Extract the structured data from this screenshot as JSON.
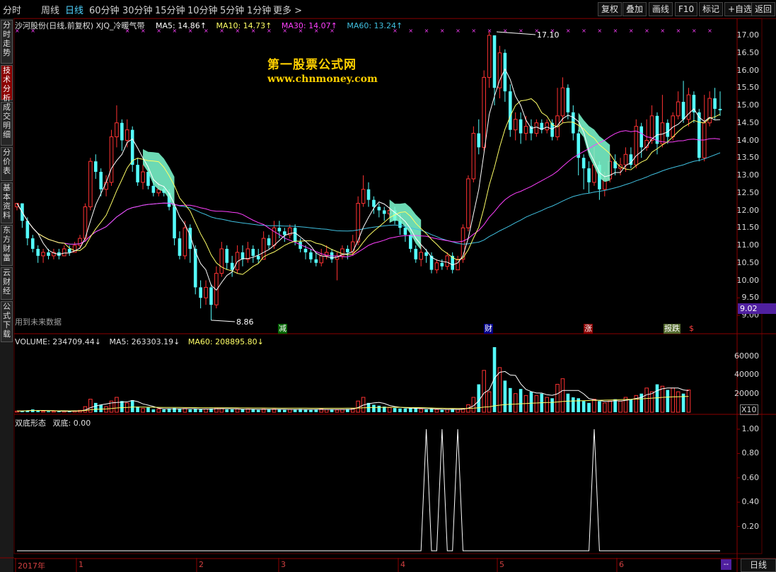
{
  "toolbar": {
    "periods": [
      "分时",
      "周线",
      "日线",
      "60分钟",
      "30分钟",
      "15分钟",
      "10分钟",
      "5分钟",
      "1分钟",
      "更多 >"
    ],
    "active_period": "日线",
    "right_buttons": [
      "复权",
      "叠加",
      "画线",
      "F10",
      "标记",
      "+自选",
      "返回"
    ]
  },
  "leftnav": {
    "tabs": [
      "分时走势",
      "技术分析",
      "成交明细",
      "分价表",
      "基本资料",
      "东方财富",
      "云财经",
      "公式下载"
    ],
    "active": "技术分析"
  },
  "main_info": {
    "title": "沙河股份(日线,前复权) XJQ_冷暖气带",
    "ma5": "MA5: 14.86↑",
    "ma10": "MA10: 14.73↑",
    "ma30": "MA30: 14.07↑",
    "ma60": "MA60: 13.24↑",
    "future_note": "用到未来数据"
  },
  "watermark": {
    "line1": "第一股票公式网",
    "line2": "www.chnmoney.com"
  },
  "price_axis": [
    "17.00",
    "16.50",
    "16.00",
    "15.50",
    "15.00",
    "14.50",
    "14.00",
    "13.50",
    "13.00",
    "12.50",
    "12.00",
    "11.50",
    "11.00",
    "10.50",
    "10.00",
    "9.50",
    "9.00"
  ],
  "current_price": "9.02",
  "annotations": {
    "high": "17.10",
    "low": "8.86"
  },
  "events": [
    {
      "label": "减",
      "color": "#ffffff",
      "bg": "#006400"
    },
    {
      "label": "财",
      "color": "#ffffff",
      "bg": "#00008b"
    },
    {
      "label": "涨",
      "color": "#ffffff",
      "bg": "#8b0000"
    },
    {
      "label": "报跌",
      "color": "#ffffff",
      "bg": "#556b2f"
    },
    {
      "label": "$",
      "color": "#ff4040",
      "bg": "transparent"
    }
  ],
  "volume_info": {
    "volume": "VOLUME: 234709.44↓",
    "ma5": "MA5: 263303.19↓",
    "ma60": "MA60: 208895.80↓"
  },
  "volume_axis": [
    "60000",
    "40000",
    "20000"
  ],
  "volume_unit": "X10",
  "indicator_info": {
    "name": "双底形态",
    "value": "双底: 0.00"
  },
  "indicator_axis": [
    "1.00",
    "0.80",
    "0.60",
    "0.40",
    "0.20"
  ],
  "indicator_minus": "--",
  "date_axis": [
    "2017年",
    "1",
    "2",
    "3",
    "4",
    "5",
    "6"
  ],
  "period_label": "日线",
  "colors": {
    "up": "#ff3232",
    "down": "#54fcfc",
    "ma5": "#ffffff",
    "ma10": "#ffff66",
    "ma30": "#ff40ff",
    "ma60": "#40c0e0",
    "band": "#7fffd4",
    "grid": "#5a0000"
  },
  "chart_data": {
    "type": "candlestick",
    "ylim": [
      8.86,
      17.1
    ],
    "bars": [
      {
        "o": 12.1,
        "c": 12.2,
        "h": 12.2,
        "l": 12.0
      },
      {
        "o": 12.2,
        "c": 11.7,
        "h": 12.2,
        "l": 11.5
      },
      {
        "o": 11.7,
        "c": 11.2,
        "h": 11.8,
        "l": 11.0
      },
      {
        "o": 11.2,
        "c": 10.9,
        "h": 11.3,
        "l": 10.8
      },
      {
        "o": 10.9,
        "c": 10.7,
        "h": 11.0,
        "l": 10.5
      },
      {
        "o": 10.7,
        "c": 10.8,
        "h": 10.9,
        "l": 10.5
      },
      {
        "o": 10.8,
        "c": 10.7,
        "h": 10.9,
        "l": 10.6
      },
      {
        "o": 10.7,
        "c": 10.8,
        "h": 10.9,
        "l": 10.6
      },
      {
        "o": 10.8,
        "c": 10.7,
        "h": 10.9,
        "l": 10.6
      },
      {
        "o": 10.7,
        "c": 10.9,
        "h": 11.0,
        "l": 10.7
      },
      {
        "o": 10.9,
        "c": 10.8,
        "h": 11.0,
        "l": 10.7
      },
      {
        "o": 10.8,
        "c": 11.0,
        "h": 11.1,
        "l": 10.8
      },
      {
        "o": 11.0,
        "c": 11.2,
        "h": 11.3,
        "l": 10.9
      },
      {
        "o": 11.2,
        "c": 12.1,
        "h": 12.2,
        "l": 11.1
      },
      {
        "o": 12.1,
        "c": 13.4,
        "h": 13.5,
        "l": 12.0
      },
      {
        "o": 13.4,
        "c": 13.1,
        "h": 13.6,
        "l": 12.9
      },
      {
        "o": 13.1,
        "c": 12.6,
        "h": 13.2,
        "l": 12.4
      },
      {
        "o": 12.6,
        "c": 12.8,
        "h": 13.0,
        "l": 12.4
      },
      {
        "o": 12.8,
        "c": 14.1,
        "h": 14.3,
        "l": 12.7
      },
      {
        "o": 14.1,
        "c": 14.5,
        "h": 15.0,
        "l": 13.8
      },
      {
        "o": 14.5,
        "c": 14.0,
        "h": 14.6,
        "l": 13.7
      },
      {
        "o": 14.0,
        "c": 14.3,
        "h": 14.6,
        "l": 13.8
      },
      {
        "o": 14.3,
        "c": 13.3,
        "h": 14.4,
        "l": 13.1
      },
      {
        "o": 13.3,
        "c": 12.8,
        "h": 13.5,
        "l": 12.7
      },
      {
        "o": 12.8,
        "c": 13.1,
        "h": 13.3,
        "l": 12.6
      },
      {
        "o": 13.1,
        "c": 12.7,
        "h": 13.2,
        "l": 12.6
      },
      {
        "o": 12.7,
        "c": 12.5,
        "h": 12.9,
        "l": 12.4
      },
      {
        "o": 12.5,
        "c": 12.6,
        "h": 12.8,
        "l": 12.4
      },
      {
        "o": 12.6,
        "c": 12.5,
        "h": 12.7,
        "l": 12.4
      },
      {
        "o": 12.5,
        "c": 12.1,
        "h": 12.6,
        "l": 12.0
      },
      {
        "o": 12.1,
        "c": 11.2,
        "h": 12.2,
        "l": 11.0
      },
      {
        "o": 11.2,
        "c": 10.7,
        "h": 11.4,
        "l": 10.6
      },
      {
        "o": 10.7,
        "c": 11.5,
        "h": 11.7,
        "l": 10.6
      },
      {
        "o": 11.5,
        "c": 10.9,
        "h": 11.6,
        "l": 10.5
      },
      {
        "o": 10.9,
        "c": 9.8,
        "h": 11.0,
        "l": 9.6
      },
      {
        "o": 9.8,
        "c": 9.5,
        "h": 10.0,
        "l": 9.2
      },
      {
        "o": 9.5,
        "c": 9.8,
        "h": 10.0,
        "l": 9.3
      },
      {
        "o": 9.8,
        "c": 9.3,
        "h": 9.9,
        "l": 8.86
      },
      {
        "o": 9.3,
        "c": 10.2,
        "h": 10.4,
        "l": 9.2
      },
      {
        "o": 10.2,
        "c": 10.9,
        "h": 11.1,
        "l": 10.1
      },
      {
        "o": 10.9,
        "c": 10.5,
        "h": 11.0,
        "l": 10.3
      },
      {
        "o": 10.5,
        "c": 10.3,
        "h": 10.7,
        "l": 10.1
      },
      {
        "o": 10.3,
        "c": 10.8,
        "h": 11.0,
        "l": 10.2
      },
      {
        "o": 10.8,
        "c": 10.6,
        "h": 11.0,
        "l": 10.4
      },
      {
        "o": 10.6,
        "c": 10.9,
        "h": 11.1,
        "l": 10.5
      },
      {
        "o": 10.9,
        "c": 10.7,
        "h": 11.0,
        "l": 10.5
      },
      {
        "o": 10.7,
        "c": 10.6,
        "h": 10.9,
        "l": 10.5
      },
      {
        "o": 10.6,
        "c": 11.2,
        "h": 11.4,
        "l": 10.6
      },
      {
        "o": 11.2,
        "c": 11.0,
        "h": 11.3,
        "l": 10.9
      },
      {
        "o": 11.0,
        "c": 11.5,
        "h": 11.7,
        "l": 10.9
      },
      {
        "o": 11.5,
        "c": 11.4,
        "h": 11.7,
        "l": 11.2
      },
      {
        "o": 11.4,
        "c": 11.3,
        "h": 11.5,
        "l": 11.1
      },
      {
        "o": 11.3,
        "c": 11.5,
        "h": 11.6,
        "l": 11.2
      },
      {
        "o": 11.5,
        "c": 11.1,
        "h": 11.6,
        "l": 11.0
      },
      {
        "o": 11.1,
        "c": 10.9,
        "h": 11.2,
        "l": 10.8
      },
      {
        "o": 10.9,
        "c": 10.8,
        "h": 11.0,
        "l": 10.6
      },
      {
        "o": 10.8,
        "c": 10.6,
        "h": 10.9,
        "l": 10.5
      },
      {
        "o": 10.6,
        "c": 10.5,
        "h": 10.8,
        "l": 10.4
      },
      {
        "o": 10.5,
        "c": 10.7,
        "h": 10.9,
        "l": 10.4
      },
      {
        "o": 10.7,
        "c": 10.8,
        "h": 11.0,
        "l": 10.6
      },
      {
        "o": 10.8,
        "c": 10.6,
        "h": 10.9,
        "l": 10.5
      },
      {
        "o": 10.6,
        "c": 10.7,
        "h": 10.8,
        "l": 10.0
      },
      {
        "o": 10.7,
        "c": 10.9,
        "h": 11.0,
        "l": 10.6
      },
      {
        "o": 10.9,
        "c": 10.8,
        "h": 11.0,
        "l": 10.6
      },
      {
        "o": 10.8,
        "c": 11.1,
        "h": 11.3,
        "l": 10.7
      },
      {
        "o": 11.1,
        "c": 12.2,
        "h": 12.4,
        "l": 11.0
      },
      {
        "o": 12.2,
        "c": 12.6,
        "h": 13.0,
        "l": 12.1
      },
      {
        "o": 12.6,
        "c": 12.3,
        "h": 12.8,
        "l": 12.1
      },
      {
        "o": 12.3,
        "c": 12.1,
        "h": 12.4,
        "l": 11.9
      },
      {
        "o": 12.1,
        "c": 12.0,
        "h": 12.2,
        "l": 11.8
      },
      {
        "o": 12.0,
        "c": 11.9,
        "h": 12.1,
        "l": 11.7
      },
      {
        "o": 11.9,
        "c": 12.0,
        "h": 12.1,
        "l": 11.8
      },
      {
        "o": 12.0,
        "c": 11.7,
        "h": 12.1,
        "l": 11.6
      },
      {
        "o": 11.7,
        "c": 11.5,
        "h": 11.9,
        "l": 11.3
      },
      {
        "o": 11.5,
        "c": 11.3,
        "h": 11.6,
        "l": 11.1
      },
      {
        "o": 11.3,
        "c": 10.9,
        "h": 11.5,
        "l": 10.8
      },
      {
        "o": 10.9,
        "c": 10.6,
        "h": 11.0,
        "l": 10.5
      },
      {
        "o": 10.6,
        "c": 10.8,
        "h": 11.0,
        "l": 10.4
      },
      {
        "o": 10.8,
        "c": 10.7,
        "h": 10.9,
        "l": 10.5
      },
      {
        "o": 10.7,
        "c": 10.3,
        "h": 10.8,
        "l": 10.2
      },
      {
        "o": 10.3,
        "c": 10.5,
        "h": 10.6,
        "l": 10.2
      },
      {
        "o": 10.5,
        "c": 10.4,
        "h": 10.6,
        "l": 10.3
      },
      {
        "o": 10.4,
        "c": 10.7,
        "h": 10.8,
        "l": 10.3
      },
      {
        "o": 10.7,
        "c": 10.3,
        "h": 10.8,
        "l": 10.2
      },
      {
        "o": 10.3,
        "c": 10.6,
        "h": 10.7,
        "l": 10.3
      },
      {
        "o": 10.6,
        "c": 11.5,
        "h": 11.6,
        "l": 10.5
      },
      {
        "o": 11.5,
        "c": 12.9,
        "h": 13.0,
        "l": 11.4
      },
      {
        "o": 12.9,
        "c": 14.2,
        "h": 14.4,
        "l": 12.8
      },
      {
        "o": 14.2,
        "c": 13.8,
        "h": 14.6,
        "l": 13.6
      },
      {
        "o": 13.8,
        "c": 15.8,
        "h": 16.0,
        "l": 13.7
      },
      {
        "o": 15.8,
        "c": 17.0,
        "h": 17.1,
        "l": 15.5
      },
      {
        "o": 17.0,
        "c": 15.5,
        "h": 17.0,
        "l": 15.0
      },
      {
        "o": 15.5,
        "c": 16.5,
        "h": 16.7,
        "l": 15.2
      },
      {
        "o": 16.5,
        "c": 15.4,
        "h": 16.6,
        "l": 15.1
      },
      {
        "o": 15.4,
        "c": 14.3,
        "h": 15.6,
        "l": 14.1
      },
      {
        "o": 14.3,
        "c": 14.6,
        "h": 14.8,
        "l": 14.0
      },
      {
        "o": 14.6,
        "c": 14.2,
        "h": 14.8,
        "l": 13.9
      },
      {
        "o": 14.2,
        "c": 14.4,
        "h": 14.7,
        "l": 14.0
      },
      {
        "o": 14.4,
        "c": 14.2,
        "h": 14.6,
        "l": 14.0
      },
      {
        "o": 14.2,
        "c": 14.5,
        "h": 14.6,
        "l": 14.1
      },
      {
        "o": 14.5,
        "c": 14.3,
        "h": 14.6,
        "l": 14.2
      },
      {
        "o": 14.3,
        "c": 14.5,
        "h": 14.6,
        "l": 14.2
      },
      {
        "o": 14.5,
        "c": 14.1,
        "h": 14.6,
        "l": 14.0
      },
      {
        "o": 14.1,
        "c": 14.7,
        "h": 15.5,
        "l": 14.0
      },
      {
        "o": 14.7,
        "c": 15.5,
        "h": 15.8,
        "l": 14.5
      },
      {
        "o": 15.5,
        "c": 14.8,
        "h": 15.6,
        "l": 14.6
      },
      {
        "o": 14.8,
        "c": 14.2,
        "h": 15.0,
        "l": 14.0
      },
      {
        "o": 14.2,
        "c": 13.5,
        "h": 14.3,
        "l": 13.0
      },
      {
        "o": 13.5,
        "c": 13.2,
        "h": 13.6,
        "l": 12.6
      },
      {
        "o": 13.2,
        "c": 12.8,
        "h": 13.4,
        "l": 12.5
      },
      {
        "o": 12.8,
        "c": 13.3,
        "h": 13.8,
        "l": 12.7
      },
      {
        "o": 13.3,
        "c": 12.6,
        "h": 13.4,
        "l": 12.3
      },
      {
        "o": 12.6,
        "c": 12.9,
        "h": 13.1,
        "l": 12.4
      },
      {
        "o": 12.9,
        "c": 13.4,
        "h": 13.6,
        "l": 12.8
      },
      {
        "o": 13.4,
        "c": 13.2,
        "h": 13.6,
        "l": 13.0
      },
      {
        "o": 13.2,
        "c": 13.3,
        "h": 13.5,
        "l": 13.0
      },
      {
        "o": 13.3,
        "c": 13.6,
        "h": 13.8,
        "l": 13.1
      },
      {
        "o": 13.6,
        "c": 13.3,
        "h": 13.8,
        "l": 13.2
      },
      {
        "o": 13.3,
        "c": 14.4,
        "h": 14.6,
        "l": 13.2
      },
      {
        "o": 14.4,
        "c": 13.8,
        "h": 14.5,
        "l": 13.5
      },
      {
        "o": 13.8,
        "c": 14.0,
        "h": 14.6,
        "l": 13.7
      },
      {
        "o": 14.0,
        "c": 14.7,
        "h": 15.0,
        "l": 13.9
      },
      {
        "o": 14.7,
        "c": 13.9,
        "h": 14.8,
        "l": 13.6
      },
      {
        "o": 13.9,
        "c": 14.5,
        "h": 15.3,
        "l": 13.8
      },
      {
        "o": 14.5,
        "c": 14.1,
        "h": 14.6,
        "l": 13.9
      },
      {
        "o": 14.1,
        "c": 14.7,
        "h": 14.8,
        "l": 14.0
      },
      {
        "o": 14.7,
        "c": 15.1,
        "h": 15.4,
        "l": 14.6
      },
      {
        "o": 15.1,
        "c": 14.6,
        "h": 15.7,
        "l": 14.5
      },
      {
        "o": 14.6,
        "c": 15.3,
        "h": 15.5,
        "l": 14.4
      },
      {
        "o": 15.3,
        "c": 14.8,
        "h": 15.4,
        "l": 14.5
      },
      {
        "o": 14.8,
        "c": 13.5,
        "h": 14.9,
        "l": 13.4
      },
      {
        "o": 13.5,
        "c": 14.5,
        "h": 15.3,
        "l": 13.4
      },
      {
        "o": 14.5,
        "c": 15.2,
        "h": 15.4,
        "l": 14.4
      },
      {
        "o": 15.2,
        "c": 14.9,
        "h": 15.5,
        "l": 14.6
      },
      {
        "o": 14.9,
        "c": 14.86,
        "h": 15.4,
        "l": 14.7
      }
    ],
    "volumes": [
      1.2,
      1.5,
      2.0,
      3.0,
      1.8,
      1.2,
      1.0,
      1.1,
      0.9,
      1.2,
      1.0,
      1.5,
      2.0,
      6.0,
      14.0,
      10.0,
      8.0,
      6.0,
      12.0,
      16.0,
      12.0,
      10.0,
      13.0,
      6.0,
      4.0,
      5.0,
      3.0,
      3.5,
      3.0,
      4.0,
      4.5,
      3.5,
      4.0,
      3.0,
      3.5,
      3.0,
      3.5,
      4.0,
      4.5,
      4.0,
      3.0,
      3.0,
      3.5,
      3.0,
      3.5,
      3.0,
      2.5,
      3.5,
      3.0,
      3.5,
      3.0,
      2.5,
      3.0,
      3.0,
      3.5,
      3.0,
      2.5,
      3.0,
      3.5,
      3.0,
      3.0,
      2.5,
      3.0,
      3.5,
      4.0,
      12.0,
      16.0,
      10.0,
      8.0,
      7.0,
      6.0,
      5.0,
      4.5,
      4.0,
      4.0,
      4.5,
      4.0,
      3.5,
      3.0,
      3.5,
      3.0,
      2.5,
      3.0,
      3.5,
      3.0,
      4.0,
      8.0,
      16.0,
      30.0,
      45.0,
      22.0,
      70.0,
      48.0,
      34.0,
      26.0,
      20.0,
      25.0,
      18.0,
      22.0,
      18.0,
      20.0,
      16.0,
      15.0,
      30.0,
      36.0,
      20.0,
      16.0,
      15.0,
      12.0,
      10.0,
      14.0,
      12.0,
      10.0,
      12.0,
      14.0,
      12.0,
      16.0,
      14.0,
      18.0,
      20.0,
      26.0,
      22.0,
      30.0,
      28.0,
      24.0,
      26.0,
      22.0,
      20.0,
      24.0
    ],
    "double_bottom_signals": [
      78,
      81,
      84,
      110
    ]
  }
}
